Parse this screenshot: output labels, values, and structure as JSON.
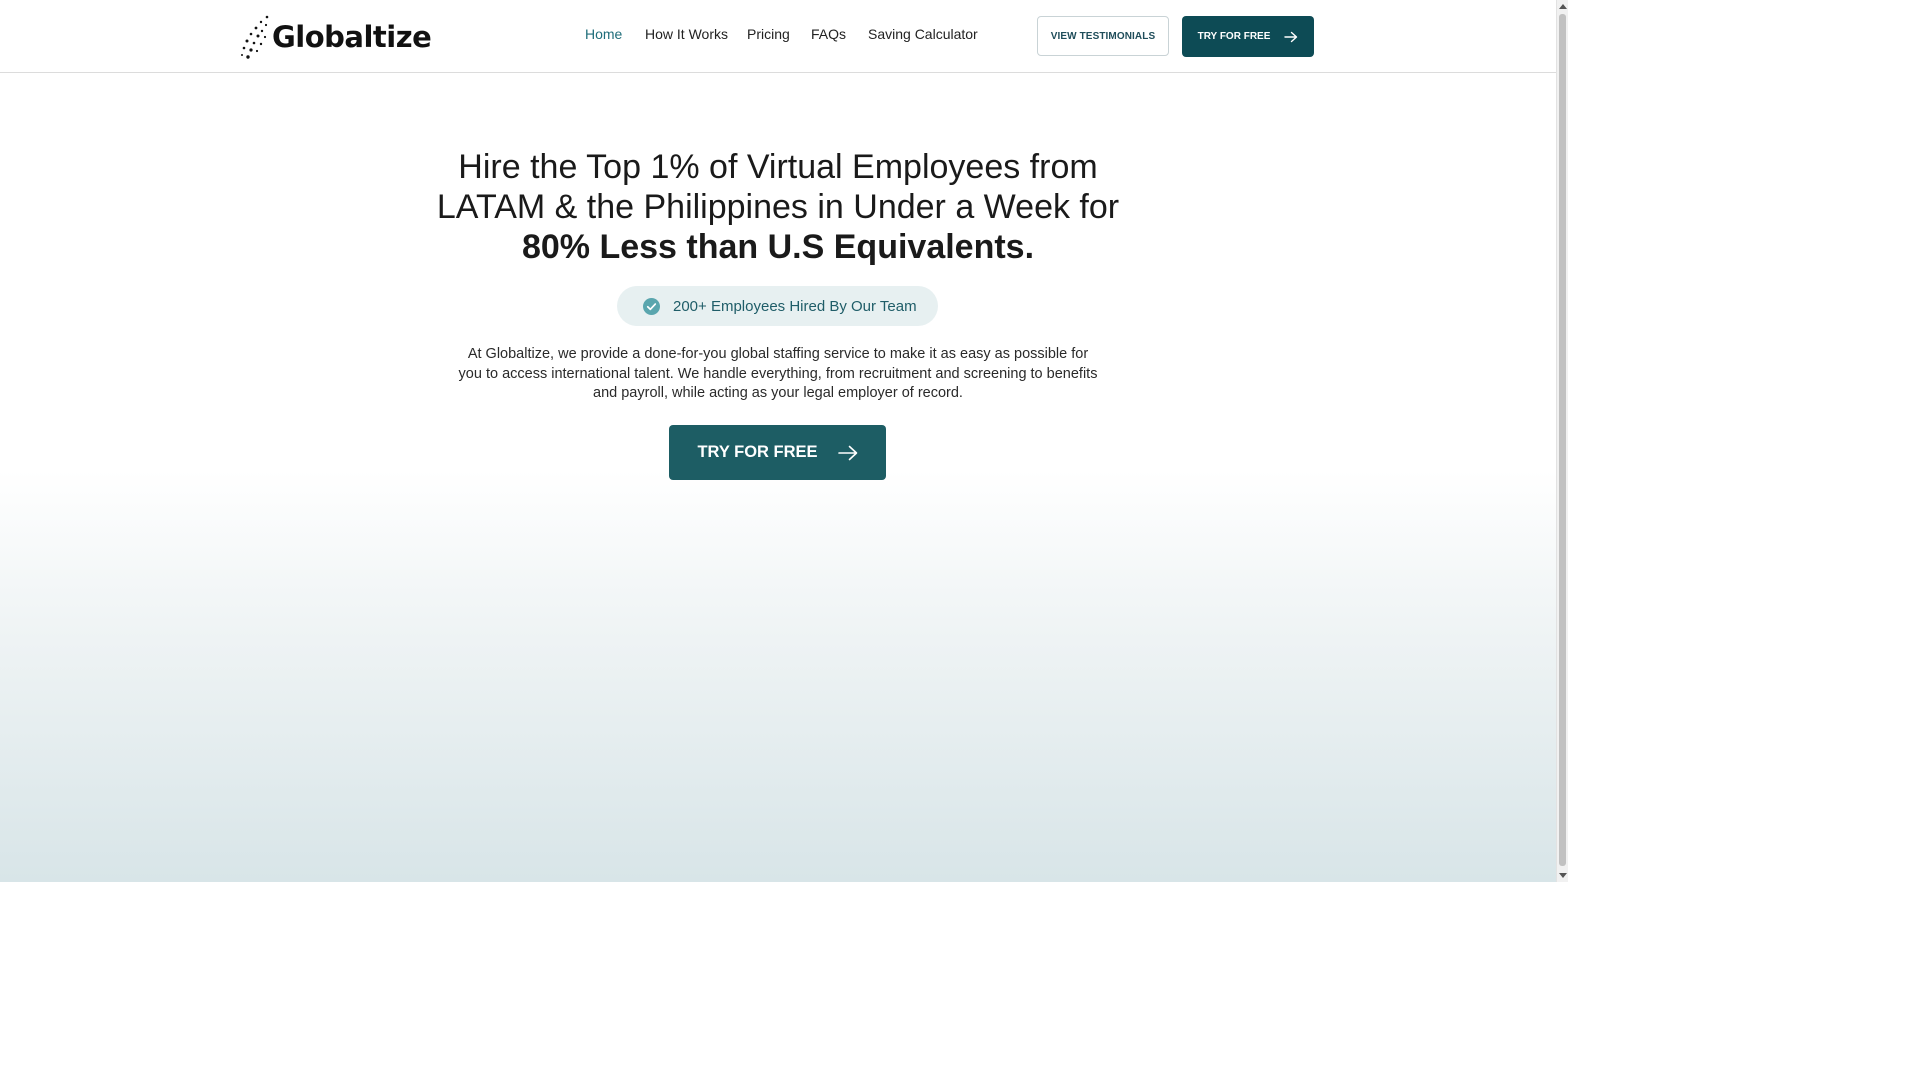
{
  "brand": {
    "name": "Globaltize",
    "logo_icon": "dotted-swoosh-logo"
  },
  "nav": {
    "items": [
      {
        "label": "Home",
        "active": true
      },
      {
        "label": "How It Works",
        "active": false
      },
      {
        "label": "Pricing",
        "active": false
      },
      {
        "label": "FAQs",
        "active": false
      },
      {
        "label": "Saving Calculator",
        "active": false
      }
    ]
  },
  "header_buttons": {
    "testimonials_label": "VIEW TESTIMONIALS",
    "try_label": "TRY FOR FREE",
    "try_icon": "arrow-right-icon"
  },
  "hero": {
    "title_line1": "Hire the Top 1% of Virtual Employees from",
    "title_line2": "LATAM & the Philippines in Under a Week for",
    "title_strong": "80% Less than U.S Equivalents.",
    "badge_text": "200+ Employees Hired By Our Team",
    "badge_icon": "check-circle-icon",
    "description": "At Globaltize, we provide a done-for-you global staffing service to make it as easy as possible for you to access international talent. We handle everything, from recruitment and screening to benefits and payroll, while acting as your legal employer of record.",
    "cta_label": "TRY FOR FREE",
    "cta_icon": "arrow-right-icon"
  },
  "colors": {
    "accent": "#0d4b55",
    "nav_active": "#1f6d7a",
    "badge_bg": "#e7f0f1",
    "check": "#5aa6ae"
  }
}
